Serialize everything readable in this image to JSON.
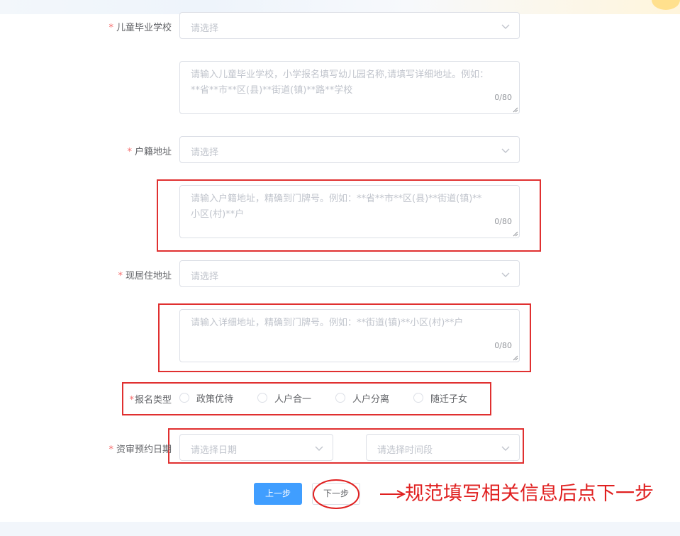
{
  "form": {
    "required_mark": "*",
    "graduation_school": {
      "label": "儿童毕业学校",
      "select_placeholder": "请选择",
      "detail_placeholder": "请输入儿童毕业学校，小学报名填写幼儿园名称,请填写详细地址。例如：**省**市**区(县)**街道(镇)**路**学校",
      "counter": "0/80"
    },
    "household_address": {
      "label": "户籍地址",
      "select_placeholder": "请选择",
      "detail_placeholder": "请输入户籍地址，精确到门牌号。例如：**省**市**区(县)**街道(镇)**小区(村)**户",
      "counter": "0/80"
    },
    "current_address": {
      "label": "现居住地址",
      "select_placeholder": "请选择",
      "detail_placeholder": "请输入详细地址，精确到门牌号。例如：**街道(镇)**小区(村)**户",
      "counter": "0/80"
    },
    "registration_type": {
      "label": "报名类型",
      "options": [
        "政策优待",
        "人户合一",
        "人户分离",
        "随迁子女"
      ]
    },
    "appointment": {
      "label": "资审预约日期",
      "date_placeholder": "请选择日期",
      "time_placeholder": "请选择时间段"
    }
  },
  "buttons": {
    "prev": "上一步",
    "next": "下一步"
  },
  "annotation": {
    "text": "规范填写相关信息后点下一步",
    "color": "#e02020"
  },
  "colors": {
    "primary": "#409eff",
    "required": "#f56c6c",
    "highlight": "#e03030"
  },
  "icons": {
    "select_arrow": "chevron-down-icon",
    "textarea_resize": "resize-grip-icon"
  }
}
